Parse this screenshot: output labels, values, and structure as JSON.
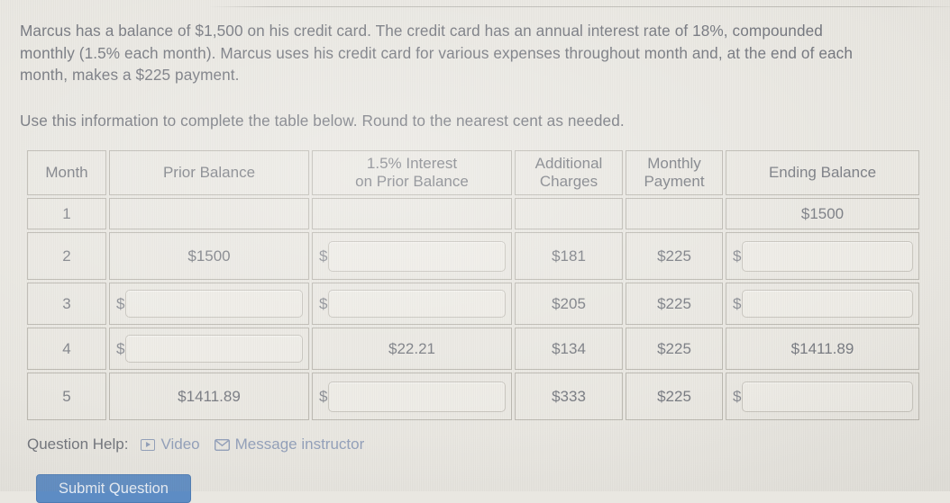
{
  "question": {
    "paragraph": "Marcus has a balance of $1,500 on his credit card. The credit card has an annual interest rate of 18%, compounded monthly (1.5% each month). Marcus uses his credit card for various expenses throughout month and, at the end of each month, makes a $225 payment.",
    "instruction": "Use this information to complete the table below. Round to the nearest cent as needed."
  },
  "table": {
    "headers": {
      "month": "Month",
      "prior_balance": "Prior Balance",
      "interest_line1": "1.5% Interest",
      "interest_line2": "on Prior Balance",
      "additional_line1": "Additional",
      "additional_line2": "Charges",
      "payment_line1": "Monthly",
      "payment_line2": "Payment",
      "ending_balance": "Ending Balance"
    },
    "dollar_sign": "$",
    "rows": [
      {
        "month": "1",
        "prior_balance": {
          "type": "empty",
          "value": ""
        },
        "interest": {
          "type": "empty",
          "value": ""
        },
        "additional": {
          "type": "empty",
          "value": ""
        },
        "payment": {
          "type": "empty",
          "value": ""
        },
        "ending": {
          "type": "text",
          "value": "$1500"
        }
      },
      {
        "month": "2",
        "prior_balance": {
          "type": "text",
          "value": "$1500"
        },
        "interest": {
          "type": "input",
          "value": ""
        },
        "additional": {
          "type": "text",
          "value": "$181"
        },
        "payment": {
          "type": "text",
          "value": "$225"
        },
        "ending": {
          "type": "input",
          "value": ""
        }
      },
      {
        "month": "3",
        "prior_balance": {
          "type": "input",
          "value": ""
        },
        "interest": {
          "type": "input",
          "value": ""
        },
        "additional": {
          "type": "text",
          "value": "$205"
        },
        "payment": {
          "type": "text",
          "value": "$225"
        },
        "ending": {
          "type": "input",
          "value": ""
        }
      },
      {
        "month": "4",
        "prior_balance": {
          "type": "input",
          "value": ""
        },
        "interest": {
          "type": "text",
          "value": "$22.21"
        },
        "additional": {
          "type": "text",
          "value": "$134"
        },
        "payment": {
          "type": "text",
          "value": "$225"
        },
        "ending": {
          "type": "text",
          "value": "$1411.89"
        }
      },
      {
        "month": "5",
        "prior_balance": {
          "type": "text",
          "value": "$1411.89"
        },
        "interest": {
          "type": "input",
          "value": ""
        },
        "additional": {
          "type": "text",
          "value": "$333"
        },
        "payment": {
          "type": "text",
          "value": "$225"
        },
        "ending": {
          "type": "input",
          "value": ""
        }
      }
    ]
  },
  "footer": {
    "help_label": "Question Help:",
    "video_label": "Video",
    "message_label": "Message instructor",
    "submit_label": "Submit Question"
  },
  "colors": {
    "page_background": "#e9e7e1",
    "body_text": "#6b6e76",
    "link": "#8f9db8",
    "submit_button": "#5d8cc4",
    "cell_border": "#b9b6ae"
  }
}
